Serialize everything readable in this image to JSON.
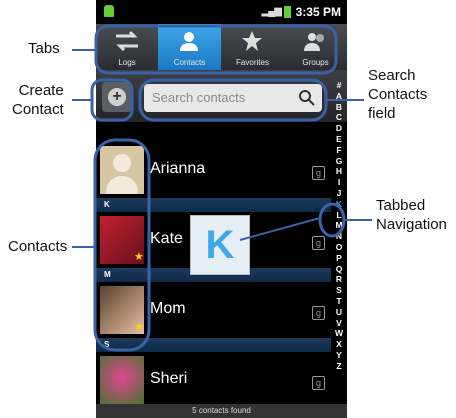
{
  "status": {
    "time": "3:35 PM"
  },
  "tabs": [
    {
      "label": "Logs"
    },
    {
      "label": "Contacts"
    },
    {
      "label": "Favorites"
    },
    {
      "label": "Groups"
    }
  ],
  "search": {
    "placeholder": "Search contacts"
  },
  "contacts": [
    {
      "name": "Arianna"
    },
    {
      "name": "Kate"
    },
    {
      "name": "Mom"
    },
    {
      "name": "Sheri"
    }
  ],
  "dividers": [
    "K",
    "M",
    "S"
  ],
  "alphabet": [
    "#",
    "A",
    "B",
    "C",
    "D",
    "E",
    "F",
    "G",
    "H",
    "I",
    "J",
    "K",
    "L",
    "M",
    "N",
    "O",
    "P",
    "Q",
    "R",
    "S",
    "T",
    "U",
    "V",
    "W",
    "X",
    "Y",
    "Z"
  ],
  "popup_letter": "K",
  "footer": "5 contacts found",
  "callouts": {
    "tabs": "Tabs",
    "create_contact": "Create\nContact",
    "search": "Search\nContacts\nfield",
    "tabbed_nav": "Tabbed\nNavigation",
    "contacts": "Contacts"
  }
}
